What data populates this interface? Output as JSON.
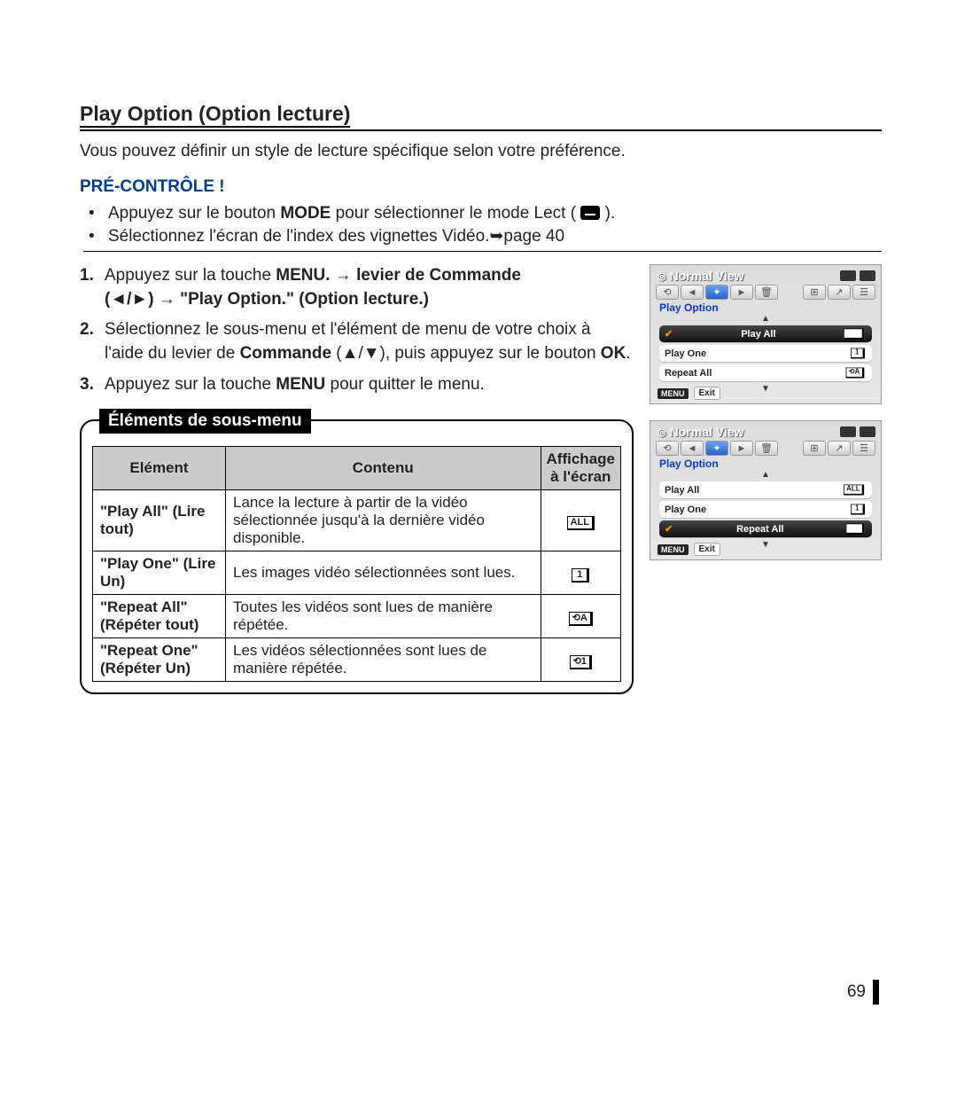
{
  "title": "Play Option (Option lecture)",
  "intro": "Vous pouvez définir un style de lecture spécifique selon votre préférence.",
  "precheck_label": "PRÉ-CONTRÔLE !",
  "precheck_items": {
    "i1a": "Appuyez sur le bouton ",
    "i1b": "MODE",
    "i1c": " pour sélectionner le mode Lect ( ",
    "i1d": " ).",
    "i2": "Sélectionnez l'écran de l'index des vignettes Vidéo.➥page 40"
  },
  "steps": {
    "s1a": "Appuyez sur la touche ",
    "s1b": "MENU. → levier de Commande",
    "s1c": "(◄/►) → \"Play Option.\" (Option lecture.)",
    "s2a": "Sélectionnez le sous-menu et l'élément de menu de votre choix à l'aide du levier de ",
    "s2b": "Commande",
    "s2c": " (▲/▼), puis appuyez sur le bouton ",
    "s2d": "OK",
    "s2e": ".",
    "s3a": "Appuyez sur la touche ",
    "s3b": "MENU",
    "s3c": " pour quitter le menu."
  },
  "submenu_header": "Éléments de sous-menu",
  "table": {
    "headers": {
      "c1": "Elément",
      "c2": "Contenu",
      "c3": "Affichage à l'écran"
    },
    "rows": [
      {
        "el": "\"Play All\" (Lire tout)",
        "con": "Lance la lecture à partir de la vidéo sélectionnée jusqu'à la dernière vidéo disponible.",
        "ic": "ALL"
      },
      {
        "el": "\"Play One\" (Lire Un)",
        "con": "Les images vidéo sélectionnées sont lues.",
        "ic": "1"
      },
      {
        "el": "\"Repeat All\" (Répéter tout)",
        "con": "Toutes les vidéos sont lues de manière répétée.",
        "ic": "⟲A"
      },
      {
        "el": "\"Repeat One\" (Répéter Un)",
        "con": "Les vidéos sélectionnées sont lues de manière répétée.",
        "ic": "⟲1"
      }
    ]
  },
  "screens": {
    "title": "Normal View",
    "menu_label": "Play Option",
    "menu_btn": "MENU",
    "exit_btn": "Exit",
    "s1_items": [
      {
        "label": "Play All",
        "sel": true,
        "icon": "ALL"
      },
      {
        "label": "Play One",
        "sel": false,
        "icon": "1"
      },
      {
        "label": "Repeat All",
        "sel": false,
        "icon": "⟲A"
      }
    ],
    "s2_items": [
      {
        "label": "Play All",
        "sel": false,
        "icon": "ALL"
      },
      {
        "label": "Play One",
        "sel": false,
        "icon": "1"
      },
      {
        "label": "Repeat All",
        "sel": true,
        "icon": "⟲A"
      }
    ]
  },
  "page_number": "69"
}
